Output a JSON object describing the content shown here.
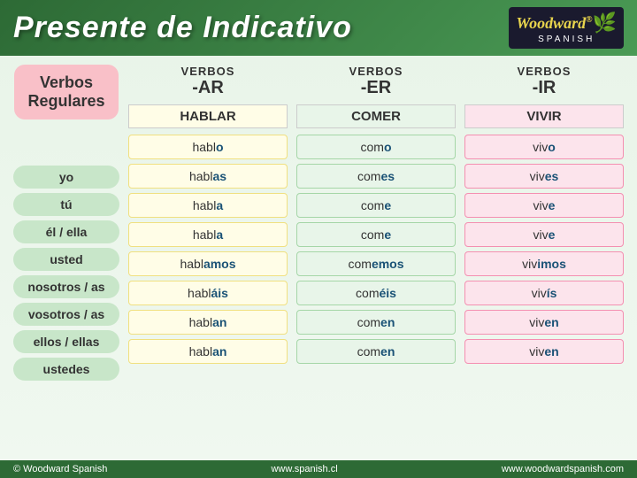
{
  "header": {
    "title": "Presente de Indicativo",
    "logo_brand": "Woodward",
    "logo_reg": "®",
    "logo_spanish": "SPANISH"
  },
  "sidebar": {
    "verbos_label": "Verbos",
    "regulares_label": "Regulares",
    "pronouns": [
      "yo",
      "tú",
      "él / ella",
      "usted",
      "nosotros / as",
      "vosotros / as",
      "ellos / ellas",
      "ustedes"
    ]
  },
  "columns": [
    {
      "id": "ar",
      "verbos_label": "VERBOS",
      "ending": "-AR",
      "example": "HABLAR",
      "conjugations": [
        {
          "stem": "habl",
          "ending": "o"
        },
        {
          "stem": "habl",
          "ending": "as"
        },
        {
          "stem": "habl",
          "ending": "a"
        },
        {
          "stem": "habl",
          "ending": "a"
        },
        {
          "stem": "habl",
          "ending": "amos"
        },
        {
          "stem": "habl",
          "ending": "áis"
        },
        {
          "stem": "habl",
          "ending": "an"
        },
        {
          "stem": "habl",
          "ending": "an"
        }
      ]
    },
    {
      "id": "er",
      "verbos_label": "VERBOS",
      "ending": "-ER",
      "example": "COMER",
      "conjugations": [
        {
          "stem": "com",
          "ending": "o"
        },
        {
          "stem": "com",
          "ending": "es"
        },
        {
          "stem": "com",
          "ending": "e"
        },
        {
          "stem": "com",
          "ending": "e"
        },
        {
          "stem": "com",
          "ending": "emos"
        },
        {
          "stem": "com",
          "ending": "éis"
        },
        {
          "stem": "com",
          "ending": "en"
        },
        {
          "stem": "com",
          "ending": "en"
        }
      ]
    },
    {
      "id": "ir",
      "verbos_label": "VERBOS",
      "ending": "-IR",
      "example": "VIVIR",
      "conjugations": [
        {
          "stem": "viv",
          "ending": "o"
        },
        {
          "stem": "viv",
          "ending": "es"
        },
        {
          "stem": "viv",
          "ending": "e"
        },
        {
          "stem": "viv",
          "ending": "e"
        },
        {
          "stem": "viv",
          "ending": "imos"
        },
        {
          "stem": "viv",
          "ending": "ís"
        },
        {
          "stem": "viv",
          "ending": "en"
        },
        {
          "stem": "viv",
          "ending": "en"
        }
      ]
    }
  ],
  "footer": {
    "copyright": "© Woodward Spanish",
    "website1": "www.spanish.cl",
    "website2": "www.woodwardspanish.com"
  }
}
